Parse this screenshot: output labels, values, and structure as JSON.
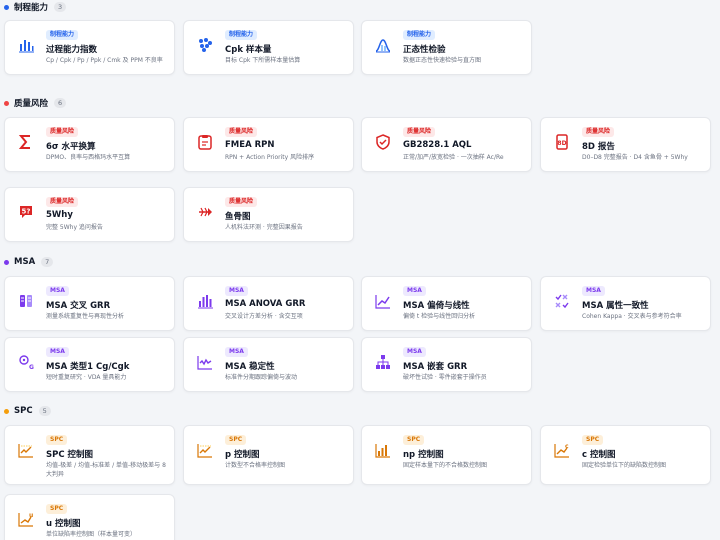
{
  "colors": {
    "capability": "#2563eb",
    "risk": "#ef4444",
    "msa": "#7c3aed",
    "spc": "#f59e0b"
  },
  "sections": [
    {
      "title": "制程能力",
      "count": "3",
      "cards": [
        {
          "badge": "制程能力",
          "name": "过程能力指数",
          "desc": "Cp / Cpk / Pp / Ppk / Cmk 及 PPM 不良率",
          "icon": "bar-chart-icon"
        },
        {
          "badge": "制程能力",
          "name": "Cpk 样本量",
          "desc": "目标 Cpk 下所需样本量估算",
          "icon": "dots-cluster-icon"
        },
        {
          "badge": "制程能力",
          "name": "正态性检验",
          "desc": "数据正态性快速检验与直方图",
          "icon": "bell-curve-icon"
        }
      ]
    },
    {
      "title": "质量风险",
      "count": "6",
      "cards": [
        {
          "badge": "质量风险",
          "name": "6σ 水平换算",
          "desc": "DPMO、良率与西格玛水平互算",
          "icon": "sigma-icon"
        },
        {
          "badge": "质量风险",
          "name": "FMEA RPN",
          "desc": "RPN + Action Priority 风险排序",
          "icon": "clipboard-icon"
        },
        {
          "badge": "质量风险",
          "name": "GB2828.1 AQL",
          "desc": "正常/加严/放宽检验 · 一次抽样 Ac/Re",
          "icon": "shield-check-icon"
        },
        {
          "badge": "质量风险",
          "name": "8D 报告",
          "desc": "D0–D8 完整报告 · D4 含鱼骨 + 5Why",
          "icon": "report-icon"
        },
        {
          "badge": "质量风险",
          "name": "5Why",
          "desc": "完整 5Why 追问报告",
          "icon": "question-bubble-icon"
        },
        {
          "badge": "质量风险",
          "name": "鱼骨图",
          "desc": "人机料法环测 · 完整因果报告",
          "icon": "fishbone-icon"
        }
      ]
    },
    {
      "title": "MSA",
      "count": "7",
      "cards": [
        {
          "badge": "MSA",
          "name": "MSA 交叉 GRR",
          "desc": "测量系统重复性与再现性分析",
          "icon": "columns-icon"
        },
        {
          "badge": "MSA",
          "name": "MSA ANOVA GRR",
          "desc": "交叉设计方差分析 · 含交互项",
          "icon": "bar-chart-icon"
        },
        {
          "badge": "MSA",
          "name": "MSA 偏倚与线性",
          "desc": "偏倚 t 检验与线性回归分析",
          "icon": "line-trend-icon"
        },
        {
          "badge": "MSA",
          "name": "MSA 属性一致性",
          "desc": "Cohen Kappa · 交叉表与参考符合率",
          "icon": "check-cross-icon"
        },
        {
          "badge": "MSA",
          "name": "MSA 类型1 Cg/Cgk",
          "desc": "短时重复研究 · VDA 量具能力",
          "icon": "gauge-icon"
        },
        {
          "badge": "MSA",
          "name": "MSA 稳定性",
          "desc": "标准件分期跟踪偏倚与波动",
          "icon": "wave-chart-icon"
        },
        {
          "badge": "MSA",
          "name": "MSA 嵌套 GRR",
          "desc": "破坏性试验 · 零件嵌套于操作员",
          "icon": "hierarchy-icon"
        }
      ]
    },
    {
      "title": "SPC",
      "count": "5",
      "cards": [
        {
          "badge": "SPC",
          "name": "SPC 控制图",
          "desc": "均值-极差 / 均值-标准差 / 单值-移动极差与 8 大判异",
          "icon": "control-chart-icon"
        },
        {
          "badge": "SPC",
          "name": "p 控制图",
          "desc": "计数型不合格率控制图",
          "icon": "control-chart-icon"
        },
        {
          "badge": "SPC",
          "name": "np 控制图",
          "desc": "固定样本量下的不合格数控制图",
          "icon": "control-chart-icon"
        },
        {
          "badge": "SPC",
          "name": "c 控制图",
          "desc": "固定检验单位下的缺陷数控制图",
          "icon": "control-chart-icon"
        },
        {
          "badge": "SPC",
          "name": "u 控制图",
          "desc": "单位缺陷率控制图（样本量可变）",
          "icon": "control-chart-icon"
        }
      ]
    }
  ]
}
